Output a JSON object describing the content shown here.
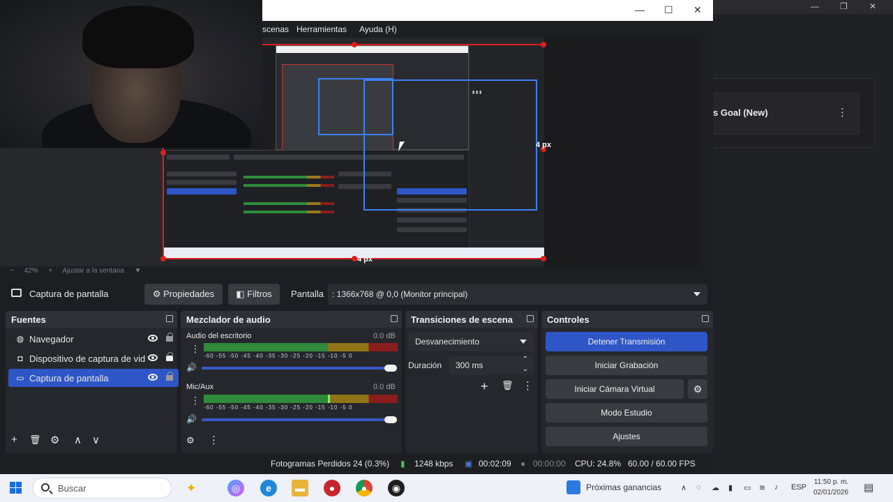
{
  "background_window": {
    "goal_card_text": "s Goal (New)",
    "more_icon": "more-vertical-icon",
    "minimize_glyph": "—",
    "restore_glyph": "❐",
    "close_glyph": "✕"
  },
  "obs": {
    "titlebar": {
      "minimize_glyph": "—",
      "maximize_glyph": "☐",
      "close_glyph": "✕"
    },
    "menu": [
      "scenas",
      "Herramientas",
      "Ayuda (H)"
    ],
    "preview": {
      "width_label": "4 px",
      "height_label": "4 px"
    },
    "zoom": {
      "minus": "−",
      "percent": "42%",
      "plus": "+",
      "fit_label": "Ajustar a la ventana"
    },
    "source_toolbar": {
      "source_name": "Captura de pantalla",
      "properties_label": "Propiedades",
      "filters_label": "Filtros",
      "display_label": "Pantalla",
      "display_value": ": 1366x768 @ 0,0 (Monitor principal)"
    },
    "sources": {
      "title": "Fuentes",
      "items": [
        {
          "label": "Navegador",
          "icon": "globe-icon",
          "selected": false
        },
        {
          "label": "Dispositivo de captura de vid",
          "icon": "camera-icon",
          "selected": false
        },
        {
          "label": "Captura de pantalla",
          "icon": "monitor-icon",
          "selected": true
        }
      ],
      "footer": [
        "+",
        "🗑",
        "⚙",
        "∧",
        "∨"
      ]
    },
    "mixer": {
      "title": "Mezclador de audio",
      "channels": [
        {
          "label": "Audio del escritorio",
          "db": "0.0 dB",
          "ticks": "-60 -55 -50 -45 -40 -35 -30 -25 -20 -15 -10 -5 0",
          "level": 0.0
        },
        {
          "label": "Mic/Aux",
          "db": "0.0 dB",
          "ticks": "-60 -55 -50 -45 -40 -35 -30 -25 -20 -15 -10 -5 0",
          "level": 0.64
        }
      ],
      "footer": [
        "⚙",
        "⋮"
      ]
    },
    "transitions": {
      "title": "Transiciones de escena",
      "selected": "Desvanecimiento",
      "duration_label": "Duración",
      "duration_value": "300 ms",
      "footer": [
        "+",
        "🗑",
        "⋮"
      ]
    },
    "controls": {
      "title": "Controles",
      "buttons": [
        "Detener Transmisión",
        "Iniciar Grabación",
        "Iniciar Cámara Virtual",
        "Modo Estudio",
        "Ajustes"
      ]
    },
    "status": {
      "dropped": "Fotogramas Perdidos 24 (0.3%)",
      "bitrate": "1248 kbps",
      "stream_time": "00:02:09",
      "rec_time": "00:00:00",
      "cpu": "CPU: 24.8%",
      "fps": "60.00 / 60.00 FPS"
    }
  },
  "taskbar": {
    "search_placeholder": "Buscar",
    "widget_text": "Próximas ganancias",
    "lang": "ESP",
    "time": "11:50 p. m.",
    "date": "02/01/2026"
  },
  "colors": {
    "accent_blue": "#2f56c7",
    "preview_red": "#e01e1e",
    "selection_blue": "#3b82f6"
  }
}
